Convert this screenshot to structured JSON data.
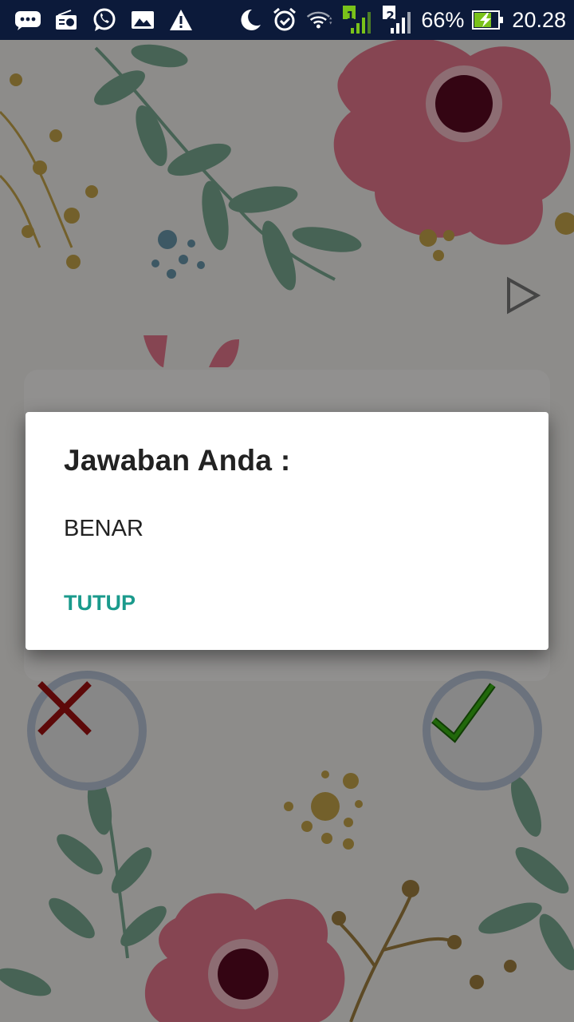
{
  "status_bar": {
    "battery_percent": "66%",
    "time": "20.28",
    "sim1_label": "1",
    "sim2_label": "2",
    "icons": [
      "chat-bubble-icon",
      "radio-icon",
      "whatsapp-icon",
      "gallery-icon",
      "warning-icon",
      "moon-icon",
      "alarm-icon",
      "wifi-icon",
      "sim1-signal-icon",
      "sim2-signal-icon",
      "battery-charging-icon"
    ]
  },
  "quiz": {
    "wrong_button_icon": "cross-icon",
    "correct_button_icon": "checkmark-icon",
    "next_icon": "play-icon"
  },
  "dialog": {
    "title": "Jawaban Anda :",
    "message": "BENAR",
    "action_label": "TUTUP"
  },
  "colors": {
    "status_bar_bg": "#0c1a3a",
    "accent": "#1a9a8c",
    "wrong": "#a01010",
    "correct": "#2a9a10"
  }
}
